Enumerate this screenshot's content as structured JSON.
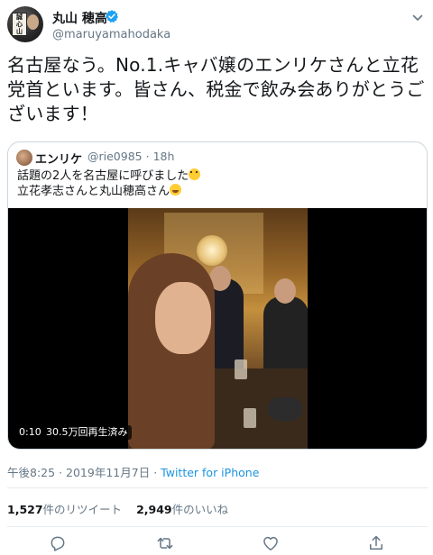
{
  "author": {
    "name": "丸山 穂高",
    "handle": "@maruyamahodaka",
    "avatar_sign": [
      "誠",
      "心",
      "山"
    ]
  },
  "tweet": {
    "text": "名古屋なう。No.1.キャバ嬢のエンリケさんと立花党首といます。皆さん、税金で飲み会ありがとうございます！"
  },
  "quoted_tweet": {
    "name": "エンリケ",
    "handle": "@rie0985",
    "separator": "·",
    "age": "18h",
    "line1": "話題の2人を名古屋に呼びました",
    "line2": "立花孝志さんと丸山穂高さん",
    "video": {
      "duration": "0:10",
      "views": "30.5万回再生済み"
    }
  },
  "meta": {
    "time": "午後8:25",
    "separator": "·",
    "date": "2019年11月7日",
    "source": "Twitter for iPhone"
  },
  "stats": {
    "retweet_count": "1,527",
    "retweet_label": "件のリツイート",
    "like_count": "2,949",
    "like_label": "件のいいね"
  },
  "icons": {
    "verified": "verified-badge-icon",
    "caret": "chevron-down-icon",
    "reply": "reply-icon",
    "retweet": "retweet-icon",
    "like": "heart-icon",
    "share": "share-icon"
  },
  "colors": {
    "accent": "#1da1f2",
    "link": "#1b95e0",
    "secondary_text": "#657786",
    "border": "#ccd6dd"
  }
}
